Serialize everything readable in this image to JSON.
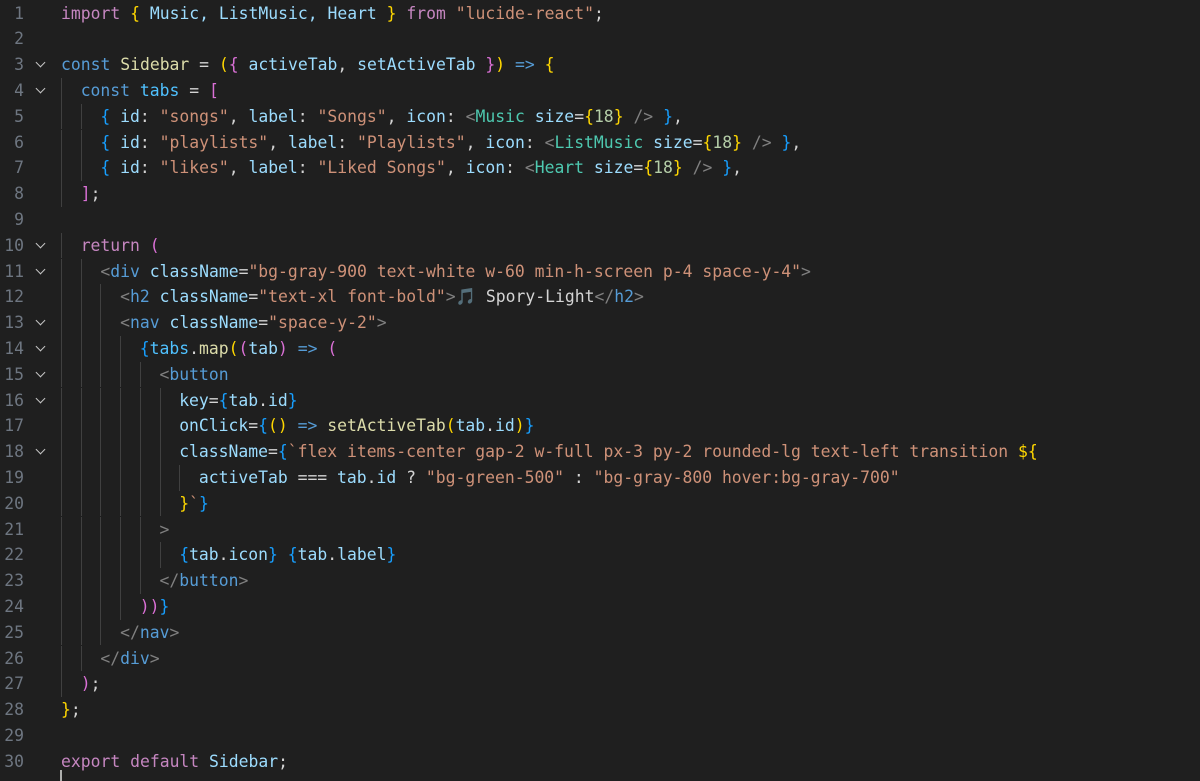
{
  "editor": {
    "language": "javascript",
    "lines": [
      {
        "number": "1",
        "fold": false,
        "indent": 0,
        "tokens": [
          {
            "t": "import",
            "c": "s-kw"
          },
          {
            "t": " ",
            "c": "s-text"
          },
          {
            "t": "{",
            "c": "s-b1"
          },
          {
            "t": " Music, ListMusic, Heart ",
            "c": "s-var"
          },
          {
            "t": "}",
            "c": "s-b1"
          },
          {
            "t": " ",
            "c": "s-text"
          },
          {
            "t": "from",
            "c": "s-kw"
          },
          {
            "t": " ",
            "c": "s-text"
          },
          {
            "t": "\"lucide-react\"",
            "c": "s-str"
          },
          {
            "t": ";",
            "c": "s-text"
          }
        ]
      },
      {
        "number": "2",
        "fold": false,
        "indent": 0,
        "tokens": []
      },
      {
        "number": "3",
        "fold": true,
        "indent": 0,
        "tokens": [
          {
            "t": "const",
            "c": "s-kd"
          },
          {
            "t": " ",
            "c": "s-text"
          },
          {
            "t": "Sidebar",
            "c": "s-fn"
          },
          {
            "t": " = ",
            "c": "s-text"
          },
          {
            "t": "(",
            "c": "s-b1"
          },
          {
            "t": "{",
            "c": "s-b2"
          },
          {
            "t": " activeTab",
            "c": "s-var"
          },
          {
            "t": ", ",
            "c": "s-text"
          },
          {
            "t": "setActiveTab ",
            "c": "s-var"
          },
          {
            "t": "}",
            "c": "s-b2"
          },
          {
            "t": ")",
            "c": "s-b1"
          },
          {
            "t": " ",
            "c": "s-text"
          },
          {
            "t": "=>",
            "c": "s-kd"
          },
          {
            "t": " ",
            "c": "s-text"
          },
          {
            "t": "{",
            "c": "s-b1"
          }
        ]
      },
      {
        "number": "4",
        "fold": true,
        "indent": 1,
        "tokens": [
          {
            "t": "const",
            "c": "s-kd"
          },
          {
            "t": " ",
            "c": "s-text"
          },
          {
            "t": "tabs",
            "c": "s-const"
          },
          {
            "t": " = ",
            "c": "s-text"
          },
          {
            "t": "[",
            "c": "s-b2"
          }
        ]
      },
      {
        "number": "5",
        "fold": false,
        "indent": 2,
        "tokens": [
          {
            "t": "{",
            "c": "s-b3"
          },
          {
            "t": " id",
            "c": "s-var"
          },
          {
            "t": ": ",
            "c": "s-text"
          },
          {
            "t": "\"songs\"",
            "c": "s-str"
          },
          {
            "t": ", ",
            "c": "s-text"
          },
          {
            "t": "label",
            "c": "s-var"
          },
          {
            "t": ": ",
            "c": "s-text"
          },
          {
            "t": "\"Songs\"",
            "c": "s-str"
          },
          {
            "t": ", ",
            "c": "s-text"
          },
          {
            "t": "icon",
            "c": "s-var"
          },
          {
            "t": ": ",
            "c": "s-text"
          },
          {
            "t": "<",
            "c": "s-punc"
          },
          {
            "t": "Music",
            "c": "s-tag"
          },
          {
            "t": " ",
            "c": "s-text"
          },
          {
            "t": "size",
            "c": "s-attr"
          },
          {
            "t": "=",
            "c": "s-text"
          },
          {
            "t": "{",
            "c": "s-b1"
          },
          {
            "t": "18",
            "c": "s-num"
          },
          {
            "t": "}",
            "c": "s-b1"
          },
          {
            "t": " ",
            "c": "s-text"
          },
          {
            "t": "/>",
            "c": "s-punc"
          },
          {
            "t": " ",
            "c": "s-text"
          },
          {
            "t": "}",
            "c": "s-b3"
          },
          {
            "t": ",",
            "c": "s-text"
          }
        ]
      },
      {
        "number": "6",
        "fold": false,
        "indent": 2,
        "tokens": [
          {
            "t": "{",
            "c": "s-b3"
          },
          {
            "t": " id",
            "c": "s-var"
          },
          {
            "t": ": ",
            "c": "s-text"
          },
          {
            "t": "\"playlists\"",
            "c": "s-str"
          },
          {
            "t": ", ",
            "c": "s-text"
          },
          {
            "t": "label",
            "c": "s-var"
          },
          {
            "t": ": ",
            "c": "s-text"
          },
          {
            "t": "\"Playlists\"",
            "c": "s-str"
          },
          {
            "t": ", ",
            "c": "s-text"
          },
          {
            "t": "icon",
            "c": "s-var"
          },
          {
            "t": ": ",
            "c": "s-text"
          },
          {
            "t": "<",
            "c": "s-punc"
          },
          {
            "t": "ListMusic",
            "c": "s-tag"
          },
          {
            "t": " ",
            "c": "s-text"
          },
          {
            "t": "size",
            "c": "s-attr"
          },
          {
            "t": "=",
            "c": "s-text"
          },
          {
            "t": "{",
            "c": "s-b1"
          },
          {
            "t": "18",
            "c": "s-num"
          },
          {
            "t": "}",
            "c": "s-b1"
          },
          {
            "t": " ",
            "c": "s-text"
          },
          {
            "t": "/>",
            "c": "s-punc"
          },
          {
            "t": " ",
            "c": "s-text"
          },
          {
            "t": "}",
            "c": "s-b3"
          },
          {
            "t": ",",
            "c": "s-text"
          }
        ]
      },
      {
        "number": "7",
        "fold": false,
        "indent": 2,
        "tokens": [
          {
            "t": "{",
            "c": "s-b3"
          },
          {
            "t": " id",
            "c": "s-var"
          },
          {
            "t": ": ",
            "c": "s-text"
          },
          {
            "t": "\"likes\"",
            "c": "s-str"
          },
          {
            "t": ", ",
            "c": "s-text"
          },
          {
            "t": "label",
            "c": "s-var"
          },
          {
            "t": ": ",
            "c": "s-text"
          },
          {
            "t": "\"Liked Songs\"",
            "c": "s-str"
          },
          {
            "t": ", ",
            "c": "s-text"
          },
          {
            "t": "icon",
            "c": "s-var"
          },
          {
            "t": ": ",
            "c": "s-text"
          },
          {
            "t": "<",
            "c": "s-punc"
          },
          {
            "t": "Heart",
            "c": "s-tag"
          },
          {
            "t": " ",
            "c": "s-text"
          },
          {
            "t": "size",
            "c": "s-attr"
          },
          {
            "t": "=",
            "c": "s-text"
          },
          {
            "t": "{",
            "c": "s-b1"
          },
          {
            "t": "18",
            "c": "s-num"
          },
          {
            "t": "}",
            "c": "s-b1"
          },
          {
            "t": " ",
            "c": "s-text"
          },
          {
            "t": "/>",
            "c": "s-punc"
          },
          {
            "t": " ",
            "c": "s-text"
          },
          {
            "t": "}",
            "c": "s-b3"
          },
          {
            "t": ",",
            "c": "s-text"
          }
        ]
      },
      {
        "number": "8",
        "fold": false,
        "indent": 1,
        "tokens": [
          {
            "t": "]",
            "c": "s-b2"
          },
          {
            "t": ";",
            "c": "s-text"
          }
        ]
      },
      {
        "number": "9",
        "fold": false,
        "indent": 0,
        "tokens": []
      },
      {
        "number": "10",
        "fold": true,
        "indent": 1,
        "tokens": [
          {
            "t": "return",
            "c": "s-kw"
          },
          {
            "t": " ",
            "c": "s-text"
          },
          {
            "t": "(",
            "c": "s-b2"
          }
        ]
      },
      {
        "number": "11",
        "fold": true,
        "indent": 2,
        "tokens": [
          {
            "t": "<",
            "c": "s-punc"
          },
          {
            "t": "div",
            "c": "s-kd"
          },
          {
            "t": " ",
            "c": "s-text"
          },
          {
            "t": "className",
            "c": "s-attr"
          },
          {
            "t": "=",
            "c": "s-text"
          },
          {
            "t": "\"bg-gray-900 text-white w-60 min-h-screen p-4 space-y-4\"",
            "c": "s-str"
          },
          {
            "t": ">",
            "c": "s-punc"
          }
        ]
      },
      {
        "number": "12",
        "fold": false,
        "indent": 3,
        "tokens": [
          {
            "t": "<",
            "c": "s-punc"
          },
          {
            "t": "h2",
            "c": "s-kd"
          },
          {
            "t": " ",
            "c": "s-text"
          },
          {
            "t": "className",
            "c": "s-attr"
          },
          {
            "t": "=",
            "c": "s-text"
          },
          {
            "t": "\"text-xl font-bold\"",
            "c": "s-str"
          },
          {
            "t": ">",
            "c": "s-punc"
          },
          {
            "t": "🎵 Spory-Light",
            "c": "s-text"
          },
          {
            "t": "</",
            "c": "s-punc"
          },
          {
            "t": "h2",
            "c": "s-kd"
          },
          {
            "t": ">",
            "c": "s-punc"
          }
        ]
      },
      {
        "number": "13",
        "fold": true,
        "indent": 3,
        "tokens": [
          {
            "t": "<",
            "c": "s-punc"
          },
          {
            "t": "nav",
            "c": "s-kd"
          },
          {
            "t": " ",
            "c": "s-text"
          },
          {
            "t": "className",
            "c": "s-attr"
          },
          {
            "t": "=",
            "c": "s-text"
          },
          {
            "t": "\"space-y-2\"",
            "c": "s-str"
          },
          {
            "t": ">",
            "c": "s-punc"
          }
        ]
      },
      {
        "number": "14",
        "fold": true,
        "indent": 4,
        "tokens": [
          {
            "t": "{",
            "c": "s-b3"
          },
          {
            "t": "tabs",
            "c": "s-const"
          },
          {
            "t": ".",
            "c": "s-text"
          },
          {
            "t": "map",
            "c": "s-fn"
          },
          {
            "t": "(",
            "c": "s-b1"
          },
          {
            "t": "(",
            "c": "s-b2"
          },
          {
            "t": "tab",
            "c": "s-var"
          },
          {
            "t": ")",
            "c": "s-b2"
          },
          {
            "t": " ",
            "c": "s-text"
          },
          {
            "t": "=>",
            "c": "s-kd"
          },
          {
            "t": " ",
            "c": "s-text"
          },
          {
            "t": "(",
            "c": "s-b2"
          }
        ]
      },
      {
        "number": "15",
        "fold": true,
        "indent": 5,
        "tokens": [
          {
            "t": "<",
            "c": "s-punc"
          },
          {
            "t": "button",
            "c": "s-kd"
          }
        ]
      },
      {
        "number": "16",
        "fold": true,
        "indent": 6,
        "tokens": [
          {
            "t": "key",
            "c": "s-attr"
          },
          {
            "t": "=",
            "c": "s-text"
          },
          {
            "t": "{",
            "c": "s-b3"
          },
          {
            "t": "tab",
            "c": "s-var"
          },
          {
            "t": ".",
            "c": "s-text"
          },
          {
            "t": "id",
            "c": "s-var"
          },
          {
            "t": "}",
            "c": "s-b3"
          }
        ]
      },
      {
        "number": "17",
        "fold": false,
        "indent": 6,
        "tokens": [
          {
            "t": "onClick",
            "c": "s-attr"
          },
          {
            "t": "=",
            "c": "s-text"
          },
          {
            "t": "{",
            "c": "s-b3"
          },
          {
            "t": "()",
            "c": "s-b1"
          },
          {
            "t": " ",
            "c": "s-text"
          },
          {
            "t": "=>",
            "c": "s-kd"
          },
          {
            "t": " ",
            "c": "s-text"
          },
          {
            "t": "setActiveTab",
            "c": "s-fn"
          },
          {
            "t": "(",
            "c": "s-b1"
          },
          {
            "t": "tab",
            "c": "s-var"
          },
          {
            "t": ".",
            "c": "s-text"
          },
          {
            "t": "id",
            "c": "s-var"
          },
          {
            "t": ")",
            "c": "s-b1"
          },
          {
            "t": "}",
            "c": "s-b3"
          }
        ]
      },
      {
        "number": "18",
        "fold": true,
        "indent": 6,
        "tokens": [
          {
            "t": "className",
            "c": "s-attr"
          },
          {
            "t": "=",
            "c": "s-text"
          },
          {
            "t": "{",
            "c": "s-b3"
          },
          {
            "t": "`flex items-center gap-2 w-full px-3 py-2 rounded-lg text-left transition ",
            "c": "s-str"
          },
          {
            "t": "${",
            "c": "s-b1"
          }
        ]
      },
      {
        "number": "19",
        "fold": false,
        "indent": 7,
        "tokens": [
          {
            "t": "activeTab",
            "c": "s-var"
          },
          {
            "t": " === ",
            "c": "s-text"
          },
          {
            "t": "tab",
            "c": "s-var"
          },
          {
            "t": ".",
            "c": "s-text"
          },
          {
            "t": "id",
            "c": "s-var"
          },
          {
            "t": " ? ",
            "c": "s-text"
          },
          {
            "t": "\"bg-green-500\"",
            "c": "s-str"
          },
          {
            "t": " : ",
            "c": "s-text"
          },
          {
            "t": "\"bg-gray-800 hover:bg-gray-700\"",
            "c": "s-str"
          }
        ]
      },
      {
        "number": "20",
        "fold": false,
        "indent": 6,
        "tokens": [
          {
            "t": "}",
            "c": "s-b1"
          },
          {
            "t": "`",
            "c": "s-str"
          },
          {
            "t": "}",
            "c": "s-b3"
          }
        ]
      },
      {
        "number": "21",
        "fold": false,
        "indent": 5,
        "tokens": [
          {
            "t": ">",
            "c": "s-punc"
          }
        ]
      },
      {
        "number": "22",
        "fold": false,
        "indent": 6,
        "tokens": [
          {
            "t": "{",
            "c": "s-b3"
          },
          {
            "t": "tab",
            "c": "s-var"
          },
          {
            "t": ".",
            "c": "s-text"
          },
          {
            "t": "icon",
            "c": "s-var"
          },
          {
            "t": "}",
            "c": "s-b3"
          },
          {
            "t": " ",
            "c": "s-text"
          },
          {
            "t": "{",
            "c": "s-b3"
          },
          {
            "t": "tab",
            "c": "s-var"
          },
          {
            "t": ".",
            "c": "s-text"
          },
          {
            "t": "label",
            "c": "s-var"
          },
          {
            "t": "}",
            "c": "s-b3"
          }
        ]
      },
      {
        "number": "23",
        "fold": false,
        "indent": 5,
        "tokens": [
          {
            "t": "</",
            "c": "s-punc"
          },
          {
            "t": "button",
            "c": "s-kd"
          },
          {
            "t": ">",
            "c": "s-punc"
          }
        ]
      },
      {
        "number": "24",
        "fold": false,
        "indent": 4,
        "tokens": [
          {
            "t": "))",
            "c": "s-b2"
          },
          {
            "t": "}",
            "c": "s-b3"
          }
        ]
      },
      {
        "number": "25",
        "fold": false,
        "indent": 3,
        "tokens": [
          {
            "t": "</",
            "c": "s-punc"
          },
          {
            "t": "nav",
            "c": "s-kd"
          },
          {
            "t": ">",
            "c": "s-punc"
          }
        ]
      },
      {
        "number": "26",
        "fold": false,
        "indent": 2,
        "tokens": [
          {
            "t": "</",
            "c": "s-punc"
          },
          {
            "t": "div",
            "c": "s-kd"
          },
          {
            "t": ">",
            "c": "s-punc"
          }
        ]
      },
      {
        "number": "27",
        "fold": false,
        "indent": 1,
        "tokens": [
          {
            "t": ")",
            "c": "s-b2"
          },
          {
            "t": ";",
            "c": "s-text"
          }
        ]
      },
      {
        "number": "28",
        "fold": false,
        "indent": 0,
        "tokens": [
          {
            "t": "}",
            "c": "s-b1"
          },
          {
            "t": ";",
            "c": "s-text"
          }
        ]
      },
      {
        "number": "29",
        "fold": false,
        "indent": 0,
        "tokens": []
      },
      {
        "number": "30",
        "fold": false,
        "indent": 0,
        "tokens": [
          {
            "t": "export",
            "c": "s-kw"
          },
          {
            "t": " ",
            "c": "s-text"
          },
          {
            "t": "default",
            "c": "s-kw"
          },
          {
            "t": " ",
            "c": "s-text"
          },
          {
            "t": "Sidebar",
            "c": "s-var"
          },
          {
            "t": ";",
            "c": "s-text"
          }
        ]
      }
    ]
  },
  "colors": {
    "background": "#1f1f1f",
    "line_number": "#6e7681",
    "keyword": "#c586c0",
    "declaration": "#569cd6",
    "string": "#ce9178",
    "component": "#4ec9b0",
    "function": "#dcdcaa"
  }
}
